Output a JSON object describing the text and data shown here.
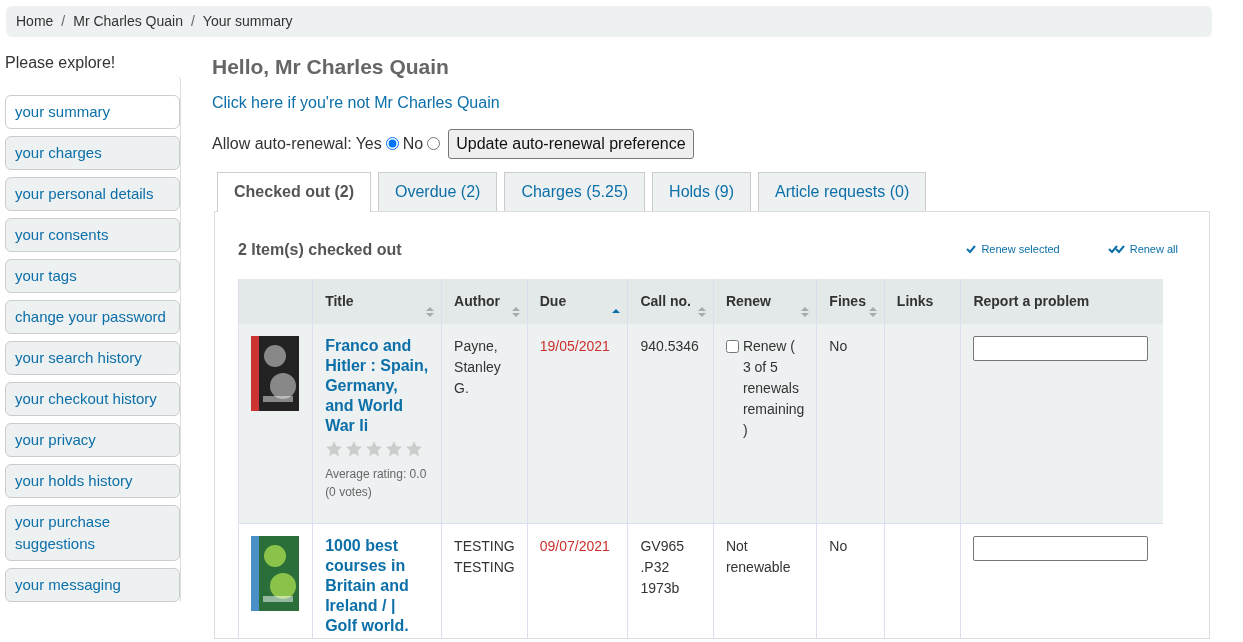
{
  "breadcrumbs": [
    {
      "label": "Home"
    },
    {
      "separator": "/",
      "label": "Mr Charles Quain"
    },
    {
      "separator": "/",
      "label": "Your summary"
    }
  ],
  "sidebar": {
    "heading": "Please explore!",
    "items": [
      {
        "label": "your summary",
        "selected": true
      },
      {
        "label": "your charges",
        "selected": false
      },
      {
        "label": "your personal details",
        "selected": false
      },
      {
        "label": "your consents",
        "selected": false
      },
      {
        "label": "your tags",
        "selected": false
      },
      {
        "label": "change your password",
        "selected": false
      },
      {
        "label": "your search history",
        "selected": false
      },
      {
        "label": "your checkout history",
        "selected": false
      },
      {
        "label": "your privacy",
        "selected": false
      },
      {
        "label": "your holds history",
        "selected": false
      },
      {
        "label": "your purchase suggestions",
        "selected": false
      },
      {
        "label": "your messaging",
        "selected": false
      }
    ]
  },
  "greeting": "Hello, Mr Charles Quain",
  "not_you_link": "Click here if you're not Mr Charles Quain",
  "auto_renewal": {
    "label": "Allow auto-renewal:",
    "options": [
      {
        "label": "Yes",
        "selected": true
      },
      {
        "label": "No",
        "selected": false
      }
    ],
    "button": "Update auto-renewal preference"
  },
  "tabs": [
    {
      "label": "Checked out (2)",
      "selected": true
    },
    {
      "label": "Overdue (2)",
      "selected": false
    },
    {
      "label": "Charges (5.25)",
      "selected": false
    },
    {
      "label": "Holds (9)",
      "selected": false
    },
    {
      "label": "Article requests (0)",
      "selected": false
    }
  ],
  "panel": {
    "heading": "2 Item(s) checked out",
    "actions": [
      {
        "kind": "single",
        "label": "Renew selected"
      },
      {
        "kind": "double",
        "label": "Renew all"
      }
    ]
  },
  "table": {
    "columns": [
      {
        "sortable": false
      },
      {
        "label": "Title",
        "sortable": true,
        "sorted": false
      },
      {
        "label": "Author",
        "sortable": true,
        "sorted": false
      },
      {
        "label": "Due",
        "sortable": true,
        "sorted": true
      },
      {
        "label": "Call no.",
        "sortable": true,
        "sorted": false
      },
      {
        "label": "Renew",
        "sortable": true,
        "sorted": false
      },
      {
        "label": "Fines",
        "sortable": true,
        "sorted": false
      },
      {
        "label": "Links",
        "sortable": false
      },
      {
        "label": "Report a problem",
        "sortable": false
      }
    ],
    "rows": [
      {
        "title": "Franco and Hitler : Spain, Germany, and World War Ii",
        "stars": 0,
        "rating_text": "Average rating: 0.0 (0 votes)",
        "author": "Payne, Stanley G.",
        "due": "19/05/2021",
        "call_no": "940.5346",
        "renew": {
          "kind": "checkbox",
          "checked": false,
          "link": "Renew",
          "note": "( 3 of 5 renewals remaining )"
        },
        "fines": "No"
      },
      {
        "title": "1000 best courses in Britain and Ireland / | Golf world.",
        "author": "TESTING TESTING",
        "due": "09/07/2021",
        "call_no": "GV965 .P32 1973b",
        "renew": {
          "kind": "text",
          "text": "Not renewable"
        },
        "fines": "No"
      }
    ]
  }
}
